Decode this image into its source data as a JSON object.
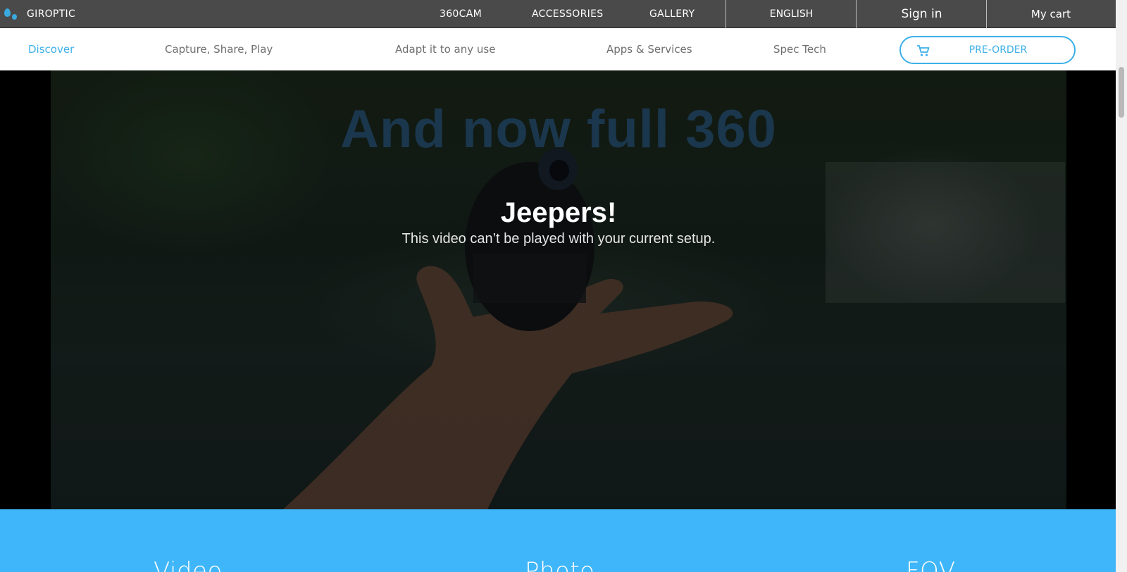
{
  "topbar": {
    "brand": "GIROPTIC",
    "nav": [
      "360CAM",
      "ACCESSORIES",
      "GALLERY"
    ],
    "language": "ENGLISH",
    "signin": "Sign in",
    "cart": "My cart",
    "colors": {
      "background": "#4a4a4a",
      "text": "#ffffff"
    }
  },
  "subnav": {
    "items": [
      "Discover",
      "Capture, Share, Play",
      "Adapt it to any use",
      "Apps & Services",
      "Spec Tech"
    ],
    "active": "Discover",
    "preorder": "PRE-ORDER",
    "colors": {
      "accent": "#3db0e8",
      "text": "#6f6f6f"
    }
  },
  "hero": {
    "title": "And now full 360",
    "error_title": "Jeepers!",
    "error_message": "This video can’t be played with your current setup."
  },
  "features": {
    "items": [
      "Video",
      "Photo",
      "FOV"
    ],
    "background": "#3fb6f9"
  },
  "icons": [
    "giroptic-logo-icon",
    "cart-icon"
  ]
}
